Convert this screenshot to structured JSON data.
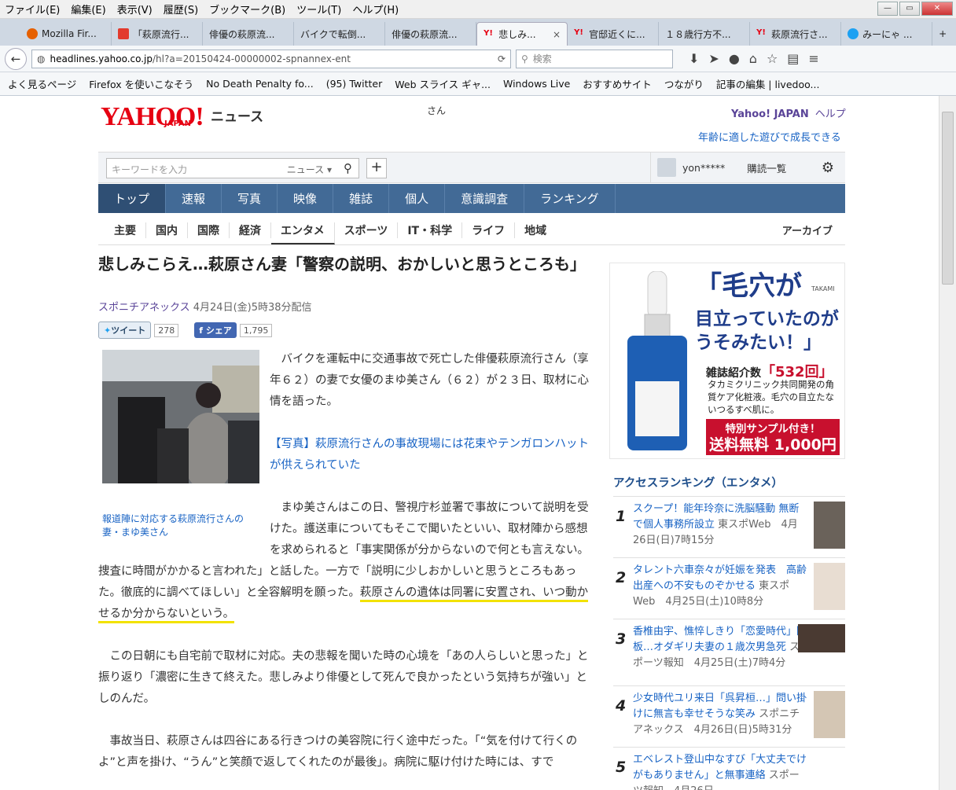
{
  "menubar": [
    "ファイル(E)",
    "編集(E)",
    "表示(V)",
    "履歴(S)",
    "ブックマーク(B)",
    "ツール(T)",
    "ヘルプ(H)"
  ],
  "tabs": [
    {
      "label": "Mozilla Fir...",
      "color": "#e66000"
    },
    {
      "label": "「萩原流行...",
      "color": "#e23a2d"
    },
    {
      "label": "俳優の萩原流...",
      "color": "#cfd8e3"
    },
    {
      "label": "バイクで転倒...",
      "color": "#cfd8e3"
    },
    {
      "label": "俳優の萩原流...",
      "color": "#cfd8e3"
    },
    {
      "label": "悲しみ...",
      "color": "#e60012",
      "active": true
    },
    {
      "label": "官邸近くに...",
      "color": "#e60012"
    },
    {
      "label": "１８歳行方不...",
      "color": "#cfd8e3"
    },
    {
      "label": "萩原流行さ...",
      "color": "#e60012"
    },
    {
      "label": "みーにゃ ...",
      "color": "#1da1f2"
    }
  ],
  "tab_close": "×",
  "new_tab": "+",
  "url": {
    "host": "headlines.yahoo.co.jp",
    "path": "/hl?a=20150424-00000002-spnannex-ent"
  },
  "browser_search_placeholder": "検索",
  "bookmarks": [
    "よく見るページ",
    "Firefox を使いこなそう",
    "No Death Penalty fo...",
    "(95) Twitter",
    "Web スライス ギャ...",
    "Windows Live",
    "おすすめサイト",
    "つながり",
    "記事の編集 | livedoo..."
  ],
  "site": {
    "logo": "YAHOO!",
    "logo_sub": "JAPAN",
    "section": "ニュース",
    "san": "さん",
    "toplinks": [
      "Yahoo! JAPAN",
      "ヘルプ"
    ],
    "promo": "年齢に適した遊びで成長できる",
    "search_placeholder": "キーワードを入力",
    "search_scope": "ニュース ▾",
    "username": "yon*****",
    "subscriptions": "購読一覧",
    "mainnav": [
      "トップ",
      "速報",
      "写真",
      "映像",
      "雑誌",
      "個人",
      "意識調査",
      "ランキング"
    ],
    "subnav": [
      "主要",
      "国内",
      "国際",
      "経済",
      "エンタメ",
      "スポーツ",
      "IT・科学",
      "ライフ",
      "地域"
    ],
    "archive": "アーカイブ"
  },
  "article": {
    "title": "悲しみこらえ…萩原さん妻「警察の説明、おかしいと思うところも」",
    "source": "スポニチアネックス",
    "date": "4月24日(金)5時38分配信",
    "tweet_label": "ツイート",
    "tweet_count": "278",
    "share_label": "シェア",
    "share_count": "1,795",
    "caption": "報道陣に対応する萩原流行さんの妻・まゆ美さん",
    "p1": "バイクを運転中に交通事故で死亡した俳優萩原流行さん（享年６２）の妻で女優のまゆ美さん（６２）が２３日、取材に心情を語った。",
    "p2_link": "【写真】萩原流行さんの事故現場には花束やテンガロンハットが供えられていた",
    "p3a": "まゆ美さんはこの日、警視庁杉並署で事故について説明を受けた。護送車についてもそこで聞いたといい、取材陣から感想を求められると「事実関係が分からないので何とも言えない。捜査に時間がかかると言われた」と話した。一方で「説明に少しおかしいと思うところもあった。徹底的に調べてほしい」と全容解明を願った。",
    "p3b": "萩原さんの遺体は同署に安置され、いつ動かせるか分からないという。",
    "p4": "この日朝にも自宅前で取材に対応。夫の悲報を聞いた時の心境を「あの人らしいと思った」と振り返り「濃密に生きて終えた。悲しみより俳優として死んで良かったという気持ちが強い」としのんだ。",
    "p5": "事故当日、萩原さんは四谷にある行きつけの美容院に行く途中だった。「“気を付けて行くのよ”と声を掛け、“うん”と笑顔で返してくれたのが最後」。病院に駆け付けた時には、すで"
  },
  "ad": {
    "line1": "「毛穴が",
    "line2": "目立っていたのが うそみたい！」",
    "count_prefix": "雑誌紹介数",
    "count": "「532回」",
    "desc": "タカミクリニック共同開発の角質ケア化粧液。毛穴の目立たないつるすべ肌に。",
    "cta1": "特別サンプル付き！",
    "cta2": "送料無料 1,000円 ▸",
    "brand": "TAKAMI"
  },
  "ranking": {
    "title": "アクセスランキング（エンタメ）",
    "items": [
      {
        "num": "1",
        "title": "スクープ！能年玲奈に洗脳騒動 無断で個人事務所設立",
        "meta": "東スポWeb　4月26日(日)7時15分"
      },
      {
        "num": "2",
        "title": "タレント六車奈々が妊娠を発表　高齢出産への不安ものぞかせる",
        "meta": "東スポWeb　4月25日(土)10時8分"
      },
      {
        "num": "3",
        "title": "香椎由宇、憔悴しきり「恋愛時代」降板…オダギリ夫妻の１歳次男急死",
        "meta": "スポーツ報知　4月25日(土)7時4分"
      },
      {
        "num": "4",
        "title": "少女時代ユリ来日「呉昇桓…」問い掛けに無言も幸せそうな笑み",
        "meta": "スポニチアネックス　4月26日(日)5時31分"
      },
      {
        "num": "5",
        "title": "エベレスト登山中なすび「大丈夫でけがもありません」と無事連絡",
        "meta": "スポーツ報知　4月26日"
      }
    ]
  }
}
